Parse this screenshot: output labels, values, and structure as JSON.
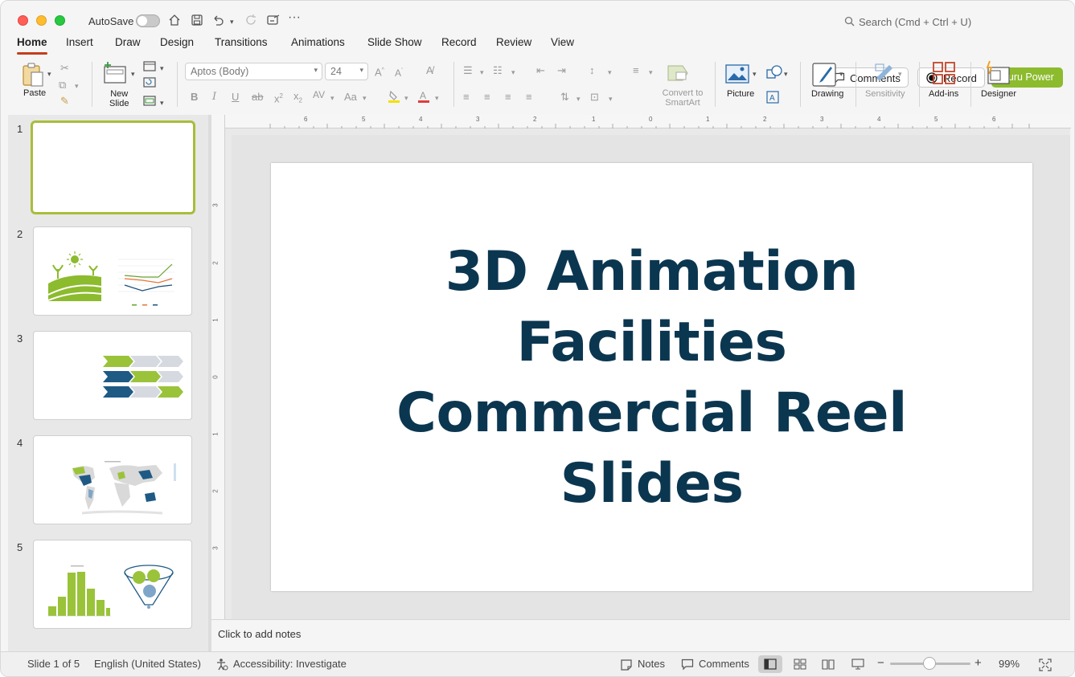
{
  "titlebar": {
    "autosave_label": "AutoSave",
    "search_placeholder": "Search (Cmd + Ctrl + U)"
  },
  "tabs": [
    {
      "label": "Home",
      "active": true
    },
    {
      "label": "Insert"
    },
    {
      "label": "Draw"
    },
    {
      "label": "Design"
    },
    {
      "label": "Transitions"
    },
    {
      "label": "Animations"
    },
    {
      "label": "Slide Show"
    },
    {
      "label": "Record"
    },
    {
      "label": "Review"
    },
    {
      "label": "View"
    }
  ],
  "header_buttons": {
    "comments": "Comments",
    "record": "Record",
    "guru": "Guru Power"
  },
  "ribbon": {
    "paste": "Paste",
    "new_slide_1": "New",
    "new_slide_2": "Slide",
    "font_name": "Aptos (Body)",
    "font_size": "24",
    "convert_smartart_1": "Convert to",
    "convert_smartart_2": "SmartArt",
    "picture": "Picture",
    "drawing": "Drawing",
    "sensitivity": "Sensitivity",
    "add_ins": "Add-ins",
    "designer": "Designer"
  },
  "thumbnails": [
    {
      "number": "1",
      "selected": true
    },
    {
      "number": "2"
    },
    {
      "number": "3"
    },
    {
      "number": "4"
    },
    {
      "number": "5"
    }
  ],
  "ruler": {
    "h_ticks": [
      "6",
      "5",
      "4",
      "3",
      "2",
      "1",
      "0",
      "1",
      "2",
      "3",
      "4",
      "5",
      "6"
    ],
    "v_ticks": [
      "3",
      "2",
      "1",
      "0",
      "1",
      "2",
      "3"
    ]
  },
  "slide": {
    "title_lines": [
      "3D Animation",
      "Facilities",
      "Commercial Reel",
      "Slides"
    ]
  },
  "notes": {
    "placeholder": "Click to add notes"
  },
  "status": {
    "slide_info": "Slide 1 of 5",
    "language": "English (United States)",
    "accessibility": "Accessibility: Investigate",
    "notes": "Notes",
    "comments": "Comments",
    "zoom": "99%"
  },
  "colors": {
    "accent_tab": "#c43e1c",
    "guru_button": "#8cbb2e",
    "title_text": "#0b3650",
    "selection_border": "#a9bd3a"
  }
}
